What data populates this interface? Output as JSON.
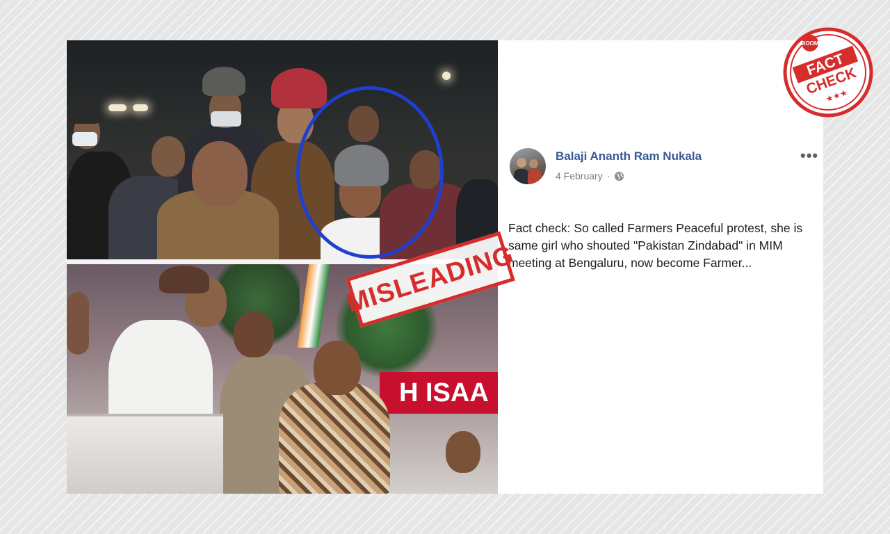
{
  "post": {
    "author": "Balaji Ananth Ram Nukala",
    "date": "4 February",
    "separator": "·",
    "privacy_icon": "globe-icon",
    "more_icon": "more-options-icon",
    "text": "Fact check: So called Farmers Peaceful protest, she is same girl who shouted \"Pakistan Zindabad\" in MIM meeting at Bengaluru, now become Farmer..."
  },
  "images": {
    "top_highlight_icon": "blue-circle-highlight",
    "bottom_banner_text": "H ISAA"
  },
  "stamps": {
    "misleading": "MISLEADING",
    "badge_brand": "BOOM",
    "badge_line1": "FACT",
    "badge_line2": "CHECK",
    "badge_stars": "★★★"
  },
  "colors": {
    "author_link": "#385898",
    "stamp_red": "#d62c2c",
    "highlight_blue": "#1f3fd0",
    "banner_red": "#c8102e"
  }
}
